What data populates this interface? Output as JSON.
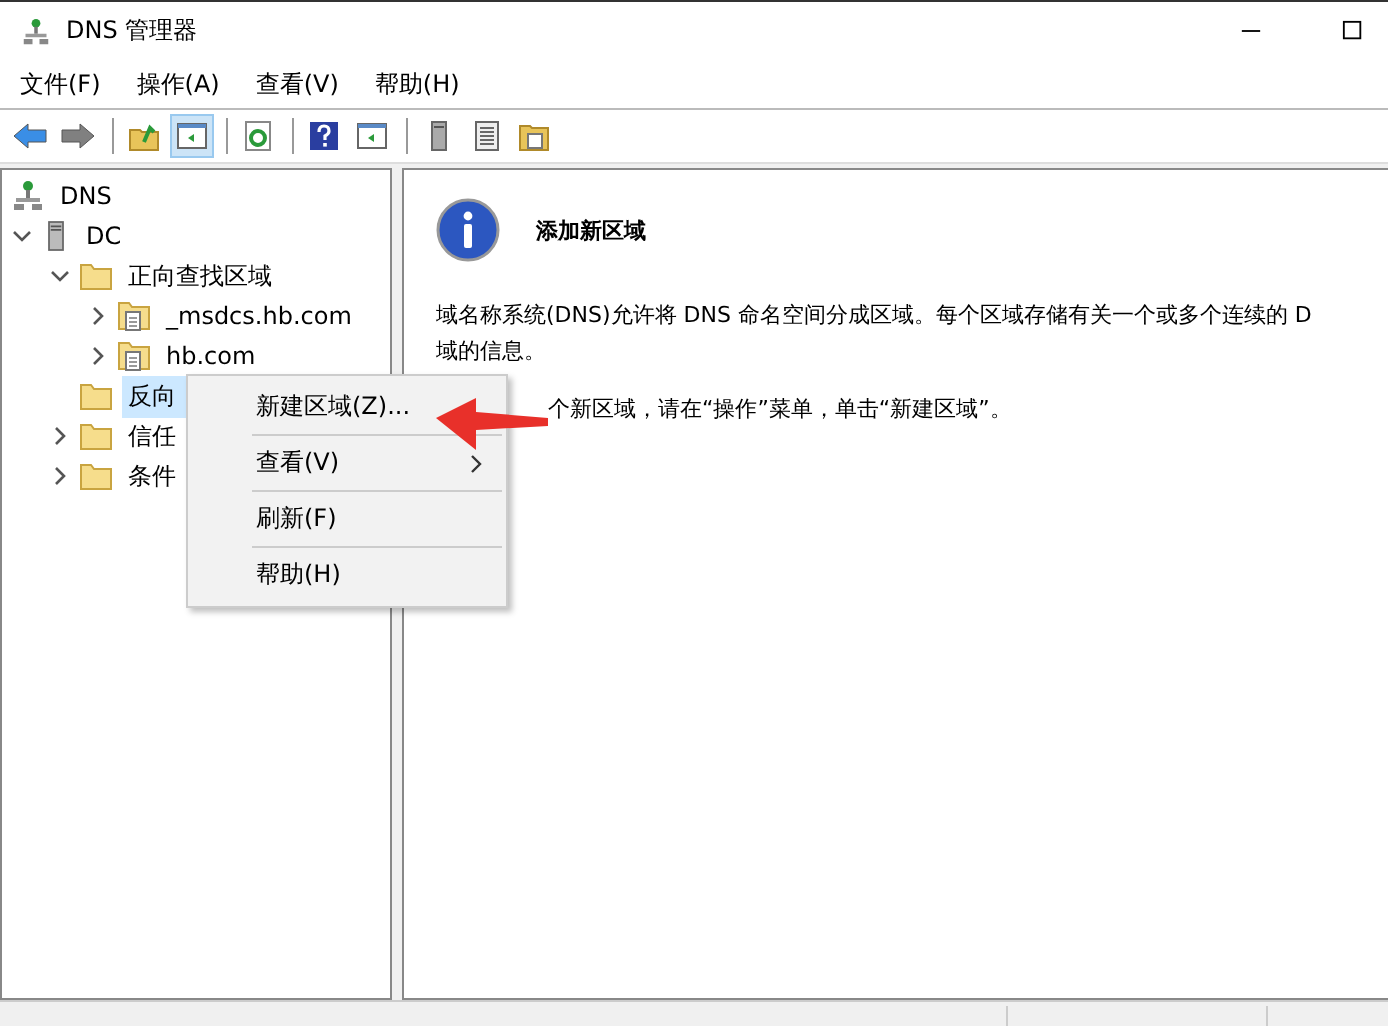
{
  "window": {
    "title": "DNS 管理器"
  },
  "menu": [
    "文件(F)",
    "操作(A)",
    "查看(V)",
    "帮助(H)"
  ],
  "toolbar": [
    {
      "kind": "back",
      "disabled": false
    },
    {
      "kind": "forward",
      "disabled": true
    },
    {
      "kind": "sep"
    },
    {
      "kind": "up"
    },
    {
      "kind": "pane",
      "selected": true
    },
    {
      "kind": "sep"
    },
    {
      "kind": "refresh"
    },
    {
      "kind": "sep"
    },
    {
      "kind": "help"
    },
    {
      "kind": "pane2"
    },
    {
      "kind": "sep"
    },
    {
      "kind": "server"
    },
    {
      "kind": "list"
    },
    {
      "kind": "zone"
    }
  ],
  "tree": [
    {
      "label": "DNS",
      "kind": "dns",
      "selected": false,
      "children": [
        {
          "label": "DC",
          "kind": "server",
          "selected": false,
          "expanded": true,
          "children": [
            {
              "label": "正向查找区域",
              "kind": "folder",
              "selected": false,
              "expanded": true,
              "children": [
                {
                  "label": "_msdcs.hb.com",
                  "kind": "zone",
                  "selected": false,
                  "expanded": false
                },
                {
                  "label": "hb.com",
                  "kind": "zone",
                  "selected": false,
                  "expanded": false
                }
              ]
            },
            {
              "label": "反向",
              "kind": "folder",
              "selected": true
            },
            {
              "label": "信任",
              "kind": "folder",
              "selected": false,
              "expanded": false
            },
            {
              "label": "条件",
              "kind": "folder",
              "selected": false,
              "expanded": false
            }
          ]
        }
      ]
    }
  ],
  "detail": {
    "heading": "添加新区域",
    "paragraph_lines": [
      "域名称系统(DNS)允许将 DNS 命名空间分成区域。每个区域存储有关一个或多个连续的 D",
      "域的信息。"
    ],
    "instruction": "个新区域，请在“操作”菜单，单击“新建区域”。"
  },
  "context_menu": [
    {
      "label": "新建区域(Z)...",
      "submenu": false
    },
    {
      "label": "查看(V)",
      "submenu": true
    },
    {
      "label": "刷新(F)",
      "submenu": false
    },
    {
      "label": "帮助(H)",
      "submenu": false
    }
  ]
}
